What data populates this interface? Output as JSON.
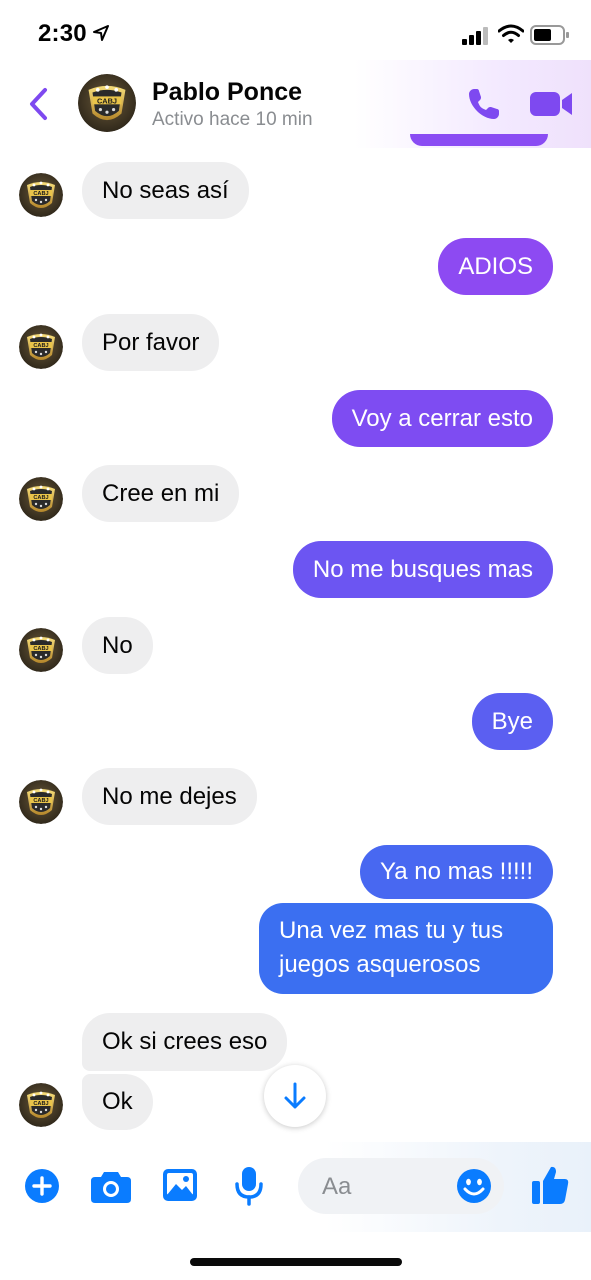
{
  "status_bar": {
    "time": "2:30"
  },
  "header": {
    "contact_name": "Pablo Ponce",
    "contact_status": "Activo hace 10 min",
    "icons": [
      "back-icon",
      "phone-icon",
      "video-camera-icon"
    ]
  },
  "colors": {
    "accent_purple": "#7e49f0",
    "bubble_violet": "#6a55f1",
    "bubble_blue": "#3b6ff1",
    "incoming_bubble": "#eeeeef",
    "messenger_blue": "#0a7cff"
  },
  "messages": [
    {
      "from": "contact",
      "text": "No seas así"
    },
    {
      "from": "me",
      "text": "ADIOS"
    },
    {
      "from": "contact",
      "text": "Por favor"
    },
    {
      "from": "me",
      "text": "Voy a cerrar esto"
    },
    {
      "from": "contact",
      "text": "Cree en mi"
    },
    {
      "from": "me",
      "text": "No me busques mas"
    },
    {
      "from": "contact",
      "text": "No"
    },
    {
      "from": "me",
      "text": "Bye"
    },
    {
      "from": "contact",
      "text": "No me dejes"
    },
    {
      "from": "me",
      "text": "Ya no mas !!!!!"
    },
    {
      "from": "me",
      "text": "Una vez mas tu y tus juegos asquerosos"
    },
    {
      "from": "contact",
      "text": "Ok si crees eso"
    },
    {
      "from": "contact",
      "text": "Ok"
    }
  ],
  "composer": {
    "placeholder": "Aa",
    "icons": [
      "plus-icon",
      "camera-icon",
      "gallery-icon",
      "microphone-icon",
      "emoji-icon",
      "thumbs-up-icon"
    ]
  },
  "scroll_button": {
    "icon": "arrow-down-icon"
  }
}
